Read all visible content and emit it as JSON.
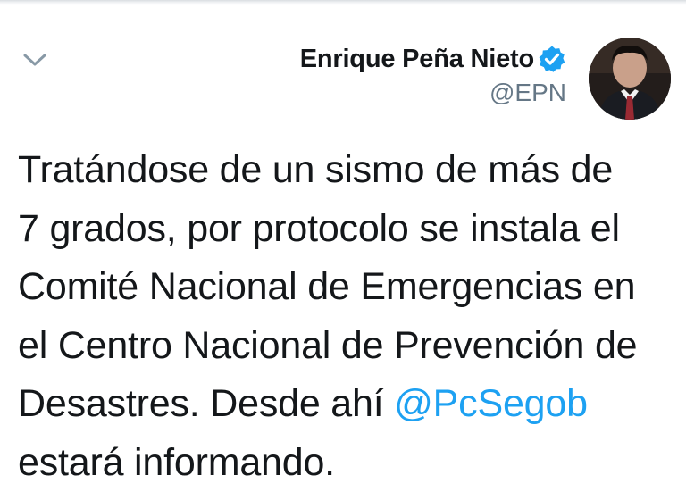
{
  "tweet": {
    "author_name": "Enrique Peña Nieto",
    "handle": "@EPN",
    "verified": true,
    "text_lines": [
      "Tratándose de un sismo de más de",
      "7 grados, por protocolo se instala el",
      "Comité Nacional de Emergencias en",
      "el Centro Nacional de Prevención de",
      "Desastres. Desde ahí ",
      "estará informando."
    ],
    "mention": "@PcSegob",
    "menu_icon": "chevron-down-icon",
    "verified_icon": "verified-badge-icon"
  },
  "colors": {
    "text": "#14171a",
    "secondary": "#657786",
    "link": "#1da1f2",
    "verified": "#1da1f2"
  }
}
